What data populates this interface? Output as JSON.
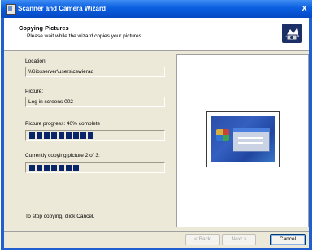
{
  "window": {
    "title": "Scanner and Camera Wizard",
    "close_glyph": "x"
  },
  "header": {
    "title": "Copying Pictures",
    "subtitle": "Please wait while the wizard copies your pictures.",
    "icon": "camera-wizard-icon"
  },
  "fields": {
    "location_label": "Location:",
    "location_value": "\\\\Gibsserver\\users\\cswierad",
    "picture_label": "Picture:",
    "picture_value": "Log in screens 002"
  },
  "progress": {
    "picture_label": "Picture progress: 40% complete",
    "picture_fraction": 0.4,
    "picture_blocks": 9,
    "copy_label": "Currently copying picture 2 of 3:",
    "copy_fraction": 0.4,
    "copy_blocks": 7
  },
  "footer": {
    "hint": "To stop copying, click Cancel."
  },
  "buttons": {
    "back": "< Back",
    "next": "Next >",
    "cancel": "Cancel"
  },
  "colors": {
    "titlebar": "#0a5fe0",
    "progress_fill": "#0a246a",
    "dialog_bg": "#ece9d8"
  }
}
